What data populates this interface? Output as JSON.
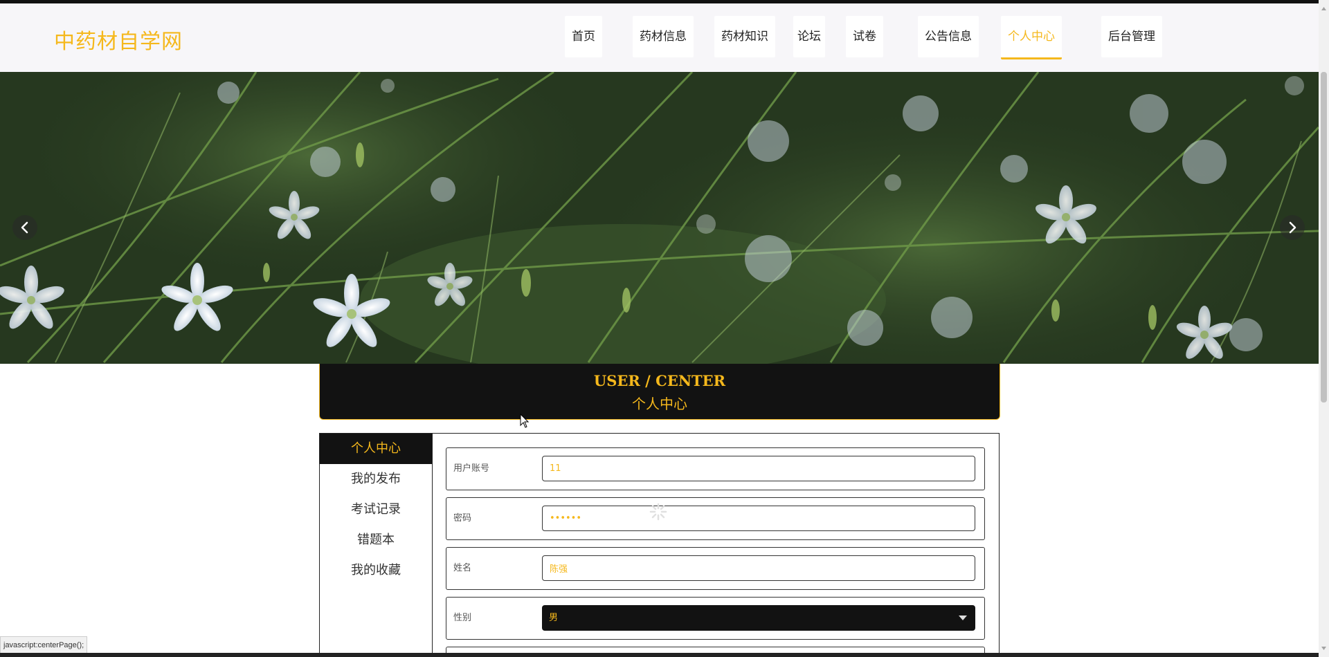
{
  "site": {
    "logo": "中药材自学网"
  },
  "nav": {
    "items": [
      {
        "label": "首页",
        "active": false
      },
      {
        "label": "药材信息",
        "active": false
      },
      {
        "label": "药材知识",
        "active": false
      },
      {
        "label": "论坛",
        "active": false
      },
      {
        "label": "试卷",
        "active": false
      },
      {
        "label": "公告信息",
        "active": false
      },
      {
        "label": "个人中心",
        "active": true
      },
      {
        "label": "后台管理",
        "active": false
      }
    ]
  },
  "banner": {
    "prev_icon": "chevron-left-icon",
    "next_icon": "chevron-right-icon"
  },
  "section": {
    "title_en": "USER / CENTER",
    "title_zh": "个人中心"
  },
  "side_menu": {
    "items": [
      {
        "label": "个人中心",
        "active": true
      },
      {
        "label": "我的发布",
        "active": false
      },
      {
        "label": "考试记录",
        "active": false
      },
      {
        "label": "错题本",
        "active": false
      },
      {
        "label": "我的收藏",
        "active": false
      }
    ]
  },
  "form": {
    "account_label": "用户账号",
    "account_value": "11",
    "password_label": "密码",
    "password_value": "••••••",
    "name_label": "姓名",
    "name_value": "陈强",
    "gender_label": "性别",
    "gender_value": "男"
  },
  "status_bar": {
    "text": "javascript:centerPage();"
  },
  "colors": {
    "accent": "#f5b81c",
    "dark": "#121212",
    "header_bg": "#f7f6f9"
  }
}
